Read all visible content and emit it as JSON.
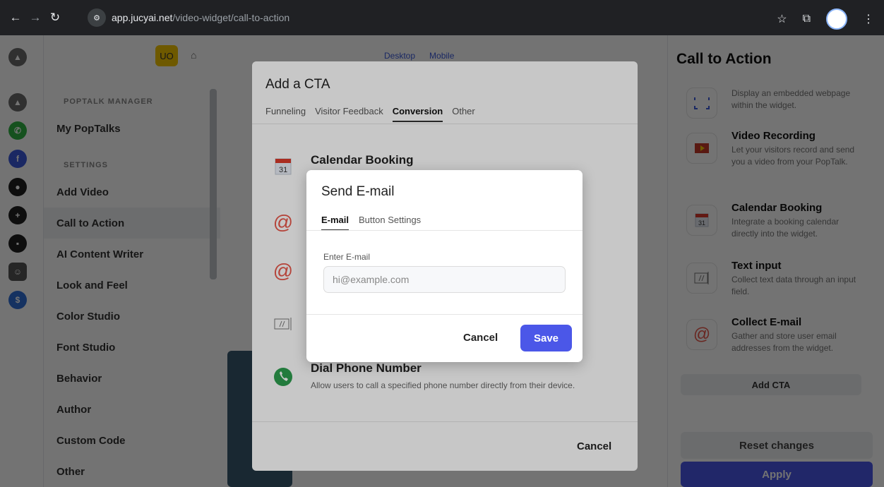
{
  "browser": {
    "url_host": "app.jucyai.net",
    "url_path": "/video-widget/call-to-action"
  },
  "header": {
    "avatar_initials": "UO"
  },
  "sidebar": {
    "section_manager": "POPTALK MANAGER",
    "manager_items": [
      "My PopTalks"
    ],
    "section_settings": "SETTINGS",
    "items": [
      "Add Video",
      "Call to Action",
      "AI Content Writer",
      "Look and Feel",
      "Color Studio",
      "Font Studio",
      "Behavior",
      "Author",
      "Custom Code",
      "Other"
    ],
    "active_item": "Call to Action"
  },
  "preview": {
    "tabs": [
      "Desktop",
      "Mobile"
    ]
  },
  "right_panel": {
    "title": "Call to Action",
    "cards": [
      {
        "name": "",
        "desc": "Display an embedded webpage within the widget.",
        "icon": "embed-icon"
      },
      {
        "name": "Video Recording",
        "desc": "Let your visitors record and send you a video from your PopTalk.",
        "icon": "video-recording-icon"
      },
      {
        "name": "Calendar Booking",
        "desc": "Integrate a booking calendar directly into the widget.",
        "icon": "calendar-icon"
      },
      {
        "name": "Text input",
        "desc": "Collect text data through an input field.",
        "icon": "text-input-icon"
      },
      {
        "name": "Collect E-mail",
        "desc": "Gather and store user email addresses from the widget.",
        "icon": "at-icon"
      }
    ],
    "add_cta": "Add CTA",
    "reset": "Reset changes",
    "apply": "Apply"
  },
  "cta_modal": {
    "title": "Add a CTA",
    "tabs": [
      "Funneling",
      "Visitor Feedback",
      "Conversion",
      "Other"
    ],
    "active_tab": "Conversion",
    "items": [
      {
        "title": "Calendar Booking",
        "desc": ""
      },
      {
        "title": "Dial Phone Number",
        "desc": "Allow users to call a specified phone number directly from their device."
      }
    ],
    "calendar_day": "31",
    "cancel": "Cancel"
  },
  "email_modal": {
    "title": "Send E-mail",
    "tabs": [
      "E-mail",
      "Button Settings"
    ],
    "active_tab": "E-mail",
    "field_label": "Enter E-mail",
    "field_placeholder": "hi@example.com",
    "field_value": "",
    "cancel": "Cancel",
    "save": "Save"
  },
  "colors": {
    "accent": "#4b57e8",
    "avatar": "#f5c400",
    "at_icon": "#e8574a",
    "phone_icon": "#2e9e4f"
  }
}
